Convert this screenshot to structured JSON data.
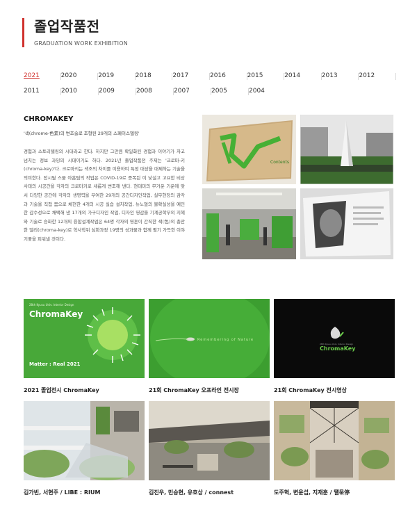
{
  "header": {
    "title": "졸업작품전",
    "subtitle": "GRADUATION WORK EXHIBITION"
  },
  "years": {
    "row1": [
      "2021",
      "2020",
      "2019",
      "2018",
      "2017",
      "2016",
      "2015",
      "2014",
      "2013",
      "2012"
    ],
    "row2": [
      "2011",
      "2010",
      "2009",
      "2008",
      "2007",
      "2005",
      "2004"
    ],
    "active": "2021"
  },
  "intro": {
    "title": "CHROMAKEY",
    "quote": "'색(chrome-色素)의 변조술로 조형된 29개의 스페이스델링'",
    "body": "경험과 스토리텔링의 시대라고 한다. 하지만 그만큼 확일화된 경험과 이야기가 차고 넘치는 정보 과잉의 시대이기도 하다. 2021년 졸업작품전 주제는 '크로마-키(chroma-key)'다. 크로마키는 색조의 차이를 이용하여 특정 대상을 대체하는 기술을 의미한다. 전시될 스물 아홉팀의 작업은 COVID-19로 증폭된 이 낯설고 고요한 비상사태의 시공간을 각자의 크로마키로 새롭게 변조해 낸다. 현대미의 무거운 기운에 맞서 다양한 공간에 각자의 생명력을 부여한 29개의 공간디자인작업, 실무현장의 감각과 기술을 직접 몸으로 체현한 4개의 시공 실습 설치작업, 뉴노멀의 불확실성을 예민한 감수성으로 채택해 낸 17개의 가구디자인 작업, 디자인 영감을 기계공학부의 지혜와 기술로 승화한 12개의 융합설계작업은 64명 각자의 영혼이 간직한 색(色)의 총만한 엘리(chroma-key)로 학사학위 심화과정 19명의 성과물과 함께 펼기 가득한 이야기꽃을 피워낼 것이다."
  },
  "top_photos": [
    {
      "name": "catalog-cover-photo",
      "caption": ""
    },
    {
      "name": "outdoor-sculpture-photo",
      "caption": ""
    },
    {
      "name": "exhibition-hall-photo",
      "caption": ""
    },
    {
      "name": "catalog-spread-photo",
      "caption": ""
    }
  ],
  "cards_row1": [
    {
      "caption": "2021 졸업전시 ChromaKey",
      "art_title": "ChromaKey",
      "art_sub1": "Matter : Real 2021",
      "art_small": "28th Kyusu Univ. Interior Design"
    },
    {
      "caption": "21회 ChromaKey 오프라인 전시장",
      "art_text": "Remembering of Nature"
    },
    {
      "caption": "21회 ChromaKey 전시영상",
      "art_title": "ChromaKey",
      "art_small": "28th Kyusu Univ. Interior Design"
    }
  ],
  "cards_row2": [
    {
      "caption": "김가빈, 서현주 / LIBE : RIUM"
    },
    {
      "caption": "김진우, 민승현, 유호상 / connest"
    },
    {
      "caption": "도주혁, 변윤섭, 지재훈 / 떌묶停"
    }
  ],
  "colors": {
    "accent": "#d0312d",
    "chroma_green": "#3fa53a",
    "dark": "#111111"
  }
}
